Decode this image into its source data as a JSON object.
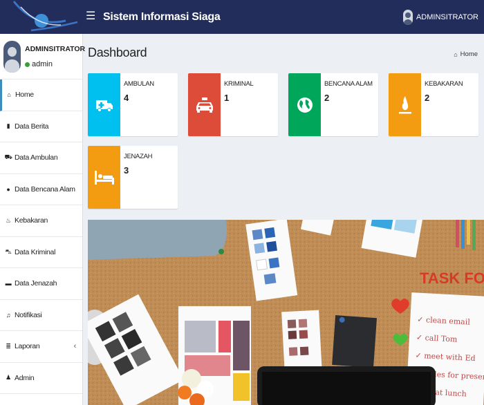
{
  "header": {
    "title": "Sistem Informasi Siaga",
    "menu_icon": "hamburger-icon",
    "user_name": "ADMINSITRATOR"
  },
  "sidebar": {
    "user": {
      "name": "ADMINSITRATOR",
      "status": "admin",
      "status_color": "#3c9c3c"
    },
    "items": [
      {
        "label": "Home",
        "icon": "home-icon"
      },
      {
        "label": "Data Berita",
        "icon": "book-icon"
      },
      {
        "label": "Data Ambulan",
        "icon": "ambulance-icon"
      },
      {
        "label": "Data Bencana Alam",
        "icon": "globe-icon"
      },
      {
        "label": "Kebakaran",
        "icon": "fire-icon"
      },
      {
        "label": "Data Kriminal",
        "icon": "car-icon"
      },
      {
        "label": "Data Jenazah",
        "icon": "bed-icon"
      },
      {
        "label": "Notifikasi",
        "icon": "bell-icon"
      },
      {
        "label": "Laporan",
        "icon": "database-icon",
        "caret": "‹"
      },
      {
        "label": "Admin",
        "icon": "user-icon"
      }
    ]
  },
  "content": {
    "title": "Dashboard",
    "breadcrumb": "Home",
    "boxes": [
      {
        "label": "AMBULAN",
        "value": "4",
        "color": "#00c0ef",
        "icon": "ambulance-icon"
      },
      {
        "label": "KRIMINAL",
        "value": "1",
        "color": "#dd4b39",
        "icon": "taxi-icon"
      },
      {
        "label": "BENCANA ALAM",
        "value": "2",
        "color": "#00a65a",
        "icon": "globe-icon"
      },
      {
        "label": "KEBAKARAN",
        "value": "2",
        "color": "#f39c12",
        "icon": "fire-icon"
      },
      {
        "label": "JENAZAH",
        "value": "3",
        "color": "#f39c12",
        "icon": "bed-icon"
      }
    ],
    "banner": {
      "task_text": "TASK FOR",
      "note_lines": [
        "✓ clean email",
        "✓ call Tom",
        "✓ meet with Ed",
        "✓ slides for presenta",
        "✓ great lunch"
      ]
    }
  },
  "colors": {
    "topbar": "#222d5c",
    "accent": "#3c8dbc",
    "content_bg": "#ecf0f5"
  }
}
